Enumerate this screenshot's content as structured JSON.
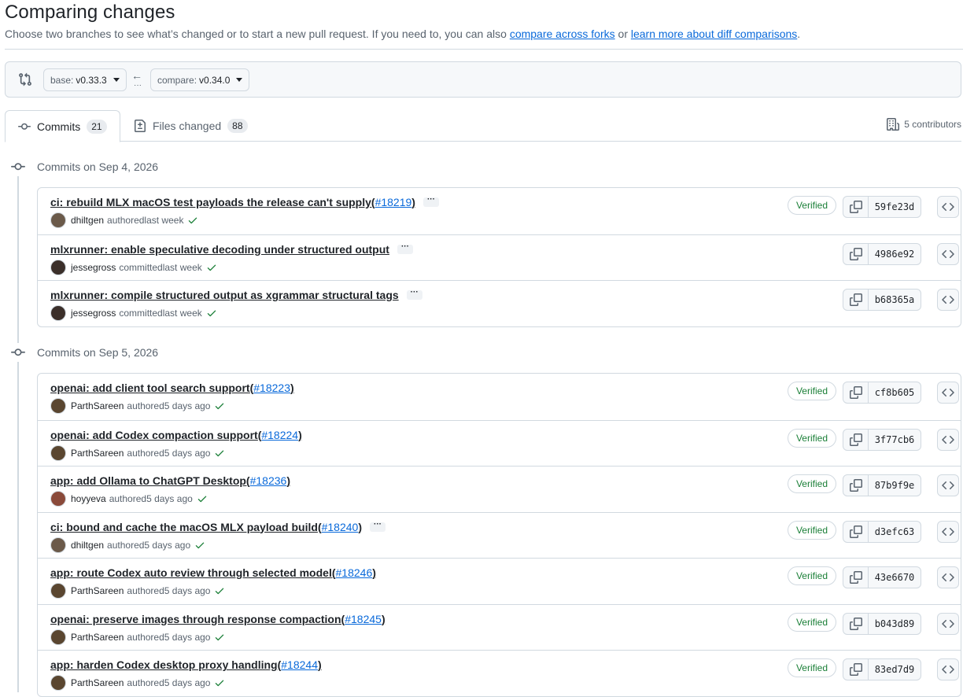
{
  "header": {
    "title": "Comparing changes",
    "subtitle_prefix": "Choose two branches to see what’s changed or to start a new pull request. If you need to, you can also ",
    "link_forks": "compare across forks",
    "subtitle_or": " or ",
    "link_learn": "learn more about diff comparisons",
    "subtitle_end": "."
  },
  "range": {
    "base_label": "base:",
    "base_value": "v0.33.3",
    "compare_label": "compare:",
    "compare_value": "v0.34.0",
    "icon": "git-compare-icon"
  },
  "tabs": {
    "commits_label": "Commits",
    "commits_count": "21",
    "files_label": "Files changed",
    "files_count": "88"
  },
  "contributors": "5 contributors",
  "groups": [
    {
      "date_label": "Commits on Sep 4, 2026",
      "commits": [
        {
          "msg": "ci: rebuild MLX macOS test payloads the release can't supply",
          "pr": "#18219",
          "author": "dhiltgen",
          "action": "authored",
          "when": "last week",
          "verified": "Verified",
          "sha": "59fe23d",
          "more": true
        },
        {
          "msg": "mlxrunner: enable speculative decoding under structured output",
          "pr": "",
          "author": "jessegross",
          "action": "committed",
          "when": "last week",
          "verified": "",
          "sha": "4986e92",
          "more": true
        },
        {
          "msg": "mlxrunner: compile structured output as xgrammar structural tags",
          "pr": "",
          "author": "jessegross",
          "action": "committed",
          "when": "last week",
          "verified": "",
          "sha": "b68365a",
          "more": true
        }
      ]
    },
    {
      "date_label": "Commits on Sep 5, 2026",
      "commits": [
        {
          "msg": "openai: add client tool search support",
          "pr": "#18223",
          "author": "ParthSareen",
          "action": "authored",
          "when": "5 days ago",
          "verified": "Verified",
          "sha": "cf8b605",
          "more": false
        },
        {
          "msg": "openai: add Codex compaction support",
          "pr": "#18224",
          "author": "ParthSareen",
          "action": "authored",
          "when": "5 days ago",
          "verified": "Verified",
          "sha": "3f77cb6",
          "more": false
        },
        {
          "msg": "app: add Ollama to ChatGPT Desktop",
          "pr": "#18236",
          "author": "hoyyeva",
          "action": "authored",
          "when": "5 days ago",
          "verified": "Verified",
          "sha": "87b9f9e",
          "more": false
        },
        {
          "msg": "ci: bound and cache the macOS MLX payload build",
          "pr": "#18240",
          "author": "dhiltgen",
          "action": "authored",
          "when": "5 days ago",
          "verified": "Verified",
          "sha": "d3efc63",
          "more": true
        },
        {
          "msg": "app: route Codex auto review through selected model",
          "pr": "#18246",
          "author": "ParthSareen",
          "action": "authored",
          "when": "5 days ago",
          "verified": "Verified",
          "sha": "43e6670",
          "more": false
        },
        {
          "msg": "openai: preserve images through response compaction",
          "pr": "#18245",
          "author": "ParthSareen",
          "action": "authored",
          "when": "5 days ago",
          "verified": "Verified",
          "sha": "b043d89",
          "more": false
        },
        {
          "msg": "app: harden Codex desktop proxy handling",
          "pr": "#18244",
          "author": "ParthSareen",
          "action": "authored",
          "when": "5 days ago",
          "verified": "Verified",
          "sha": "83ed7d9",
          "more": false
        }
      ]
    }
  ],
  "colors": {
    "link": "#0969da",
    "verified": "#1a7f37",
    "border": "#d1d9e0",
    "muted": "#59636e"
  },
  "avatar_colors": {
    "dhiltgen": "#6b5a4a",
    "jessegross": "#3b2f2a",
    "ParthSareen": "#5a4630",
    "hoyyeva": "#8a4a3a"
  }
}
